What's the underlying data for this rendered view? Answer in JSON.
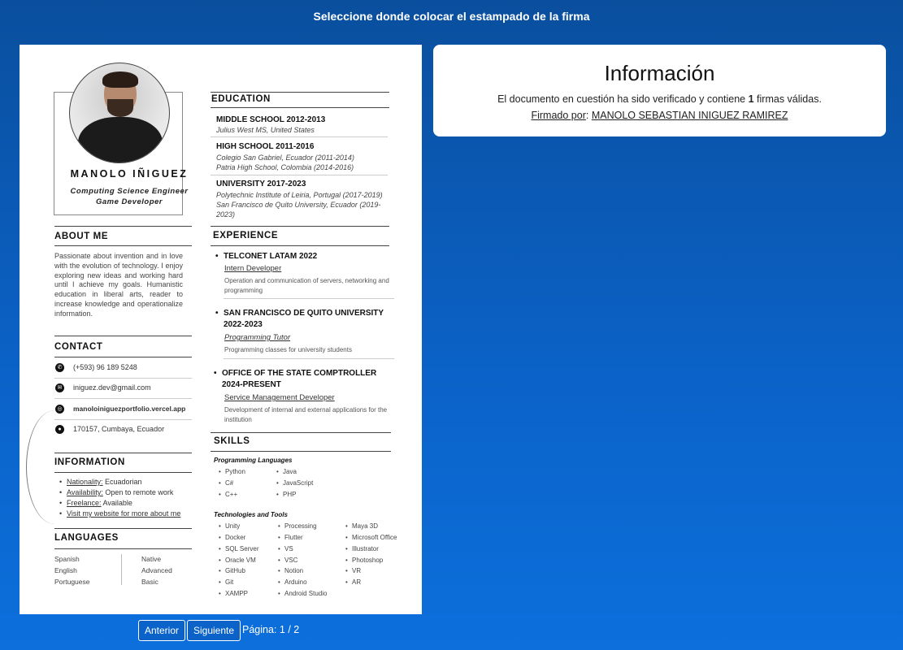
{
  "header": {
    "title": "Seleccione donde colocar el estampado de la firma"
  },
  "resume": {
    "name": "MANOLO IÑIGUEZ",
    "roles": [
      "Computing Science Engineer",
      "Game Developer"
    ],
    "about": {
      "heading": "ABOUT ME",
      "text": "Passionate about invention and in love with the evolution of technology. I enjoy exploring new ideas and working hard until I achieve my goals. Humanistic education in liberal arts, reader to increase knowledge and operationalize information."
    },
    "contact": {
      "heading": "CONTACT",
      "phone": "(+593) 96 189 5248",
      "email": "iniguez.dev@gmail.com",
      "website": "manoloiniguezportfolio.vercel.app",
      "location": "170157, Cumbaya, Ecuador"
    },
    "information": {
      "heading": "INFORMATION",
      "items": [
        {
          "label": "Nationality:",
          "value": " Ecuadorian"
        },
        {
          "label": "Availability:",
          "value": " Open to remote work"
        },
        {
          "label": "Freelance:",
          "value": " Available"
        },
        {
          "label": "Visit my website for more about me",
          "value": ""
        }
      ]
    },
    "languages": {
      "heading": "LANGUAGES",
      "items": [
        {
          "lang": "Spanish",
          "level": "Native"
        },
        {
          "lang": "English",
          "level": "Advanced"
        },
        {
          "lang": "Portuguese",
          "level": "Basic"
        }
      ]
    },
    "education": {
      "heading": "EDUCATION",
      "items": [
        {
          "title": "MIDDLE SCHOOL 2012-2013",
          "lines": [
            "Julius West MS, United States"
          ]
        },
        {
          "title": "HIGH SCHOOL 2011-2016",
          "lines": [
            "Colegio San Gabriel, Ecuador (2011-2014)",
            "Patria High School, Colombia (2014-2016)"
          ]
        },
        {
          "title": "UNIVERSITY 2017-2023",
          "lines": [
            "Polytechnic Institute of Leiria, Portugal (2017-2019)",
            "San Francisco de Quito University, Ecuador (2019-",
            "2023)"
          ]
        }
      ]
    },
    "experience": {
      "heading": "EXPERIENCE",
      "items": [
        {
          "title": "TELCONET LATAM 2022",
          "role": "Intern Developer",
          "desc": "Operation and communication of servers, networking and programming"
        },
        {
          "title": "SAN FRANCISCO DE QUITO UNIVERSITY 2022-2023",
          "role": "Programming Tutor",
          "desc": "Programming classes for university students"
        },
        {
          "title": "OFFICE OF THE STATE COMPTROLLER 2024-PRESENT",
          "role": "Service Management Developer",
          "desc": "Development of internal and external applications for the institution"
        }
      ]
    },
    "skills": {
      "heading": "SKILLS",
      "programming_heading": "Programming Languages",
      "programming": [
        "Python",
        "C#",
        "C++",
        "Java",
        "JavaScript",
        "PHP"
      ],
      "tools_heading": "Technologies and Tools",
      "tools_col1": [
        "Unity",
        "Docker",
        "SQL Server",
        "Oracle VM",
        "GitHub",
        "Git",
        "XAMPP"
      ],
      "tools_col2": [
        "Processing",
        "Flutter",
        "VS",
        "VSC",
        "Notion",
        "Arduino",
        "Android Studio"
      ],
      "tools_col3": [
        "Maya 3D",
        "Microsoft Office",
        "Illustrator",
        "Photoshop",
        "VR",
        "AR"
      ]
    }
  },
  "pager": {
    "prev_label": "Anterior",
    "next_label": "Siguiente",
    "page_label": "Página:",
    "page_value": "1 / 2"
  },
  "info": {
    "title": "Información",
    "text_before": "El documento en cuestión ha sido verificado y contiene ",
    "count": "1",
    "text_after": " firmas válidas.",
    "signed_label": "Firmado por",
    "signer": "MANOLO SEBASTIAN INIGUEZ RAMIREZ"
  },
  "colors": {
    "background": "#0b63c9",
    "card": "#ffffff"
  },
  "icons": [
    "phone-icon",
    "email-icon",
    "globe-icon",
    "location-icon"
  ]
}
